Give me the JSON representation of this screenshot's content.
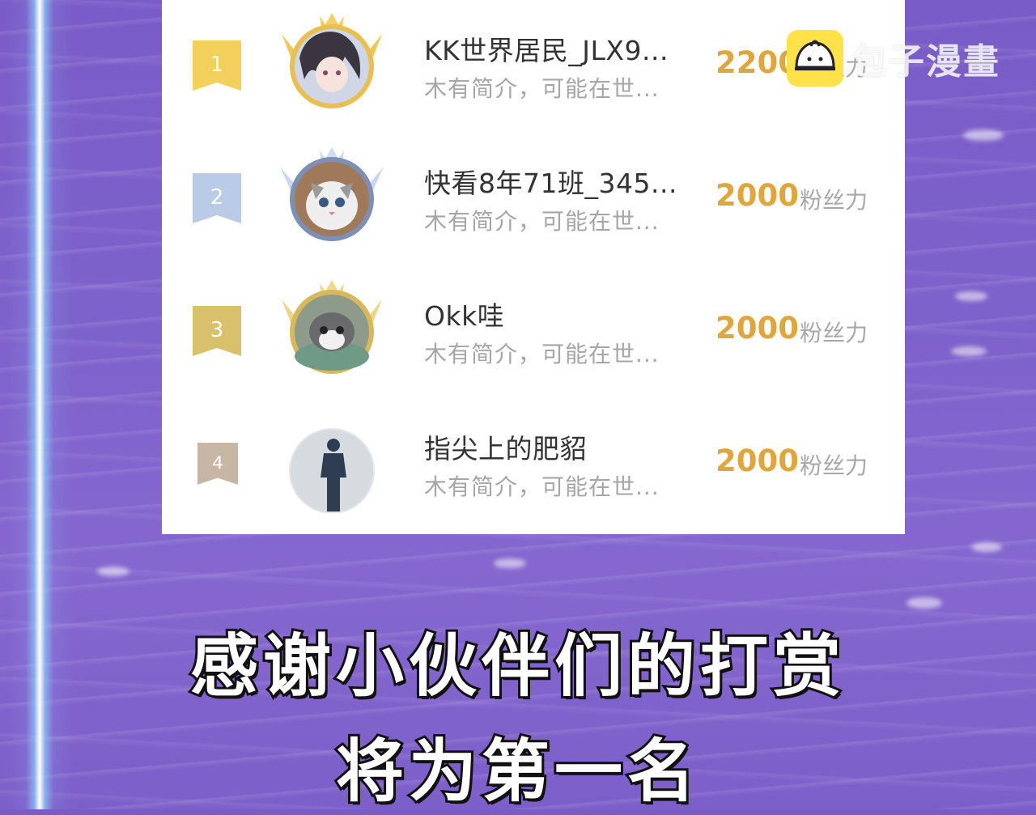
{
  "watermark": {
    "text": "包子漫畫",
    "icon": "bun-mascot-icon"
  },
  "ranking": [
    {
      "rank": "1",
      "name": "KK世界居民_JLX9...",
      "intro": "木有简介，可能在世...",
      "points": "2200",
      "unit": "粉丝力",
      "badge_color": "#f3cf5c",
      "frame": "gold"
    },
    {
      "rank": "2",
      "name": "快看8年71班_345...",
      "intro": "木有简介，可能在世...",
      "points": "2000",
      "unit": "粉丝力",
      "badge_color": "#b9cbe6",
      "frame": "silver"
    },
    {
      "rank": "3",
      "name": "Okk哇",
      "intro": "木有简介，可能在世...",
      "points": "2000",
      "unit": "粉丝力",
      "badge_color": "#d9c06d",
      "frame": "bronze-gold"
    },
    {
      "rank": "4",
      "name": "指尖上的肥貂",
      "intro": "木有简介，可能在世...",
      "points": "2000",
      "unit": "粉丝力",
      "badge_color": "#c8b6a4",
      "frame": "none"
    }
  ],
  "caption": {
    "line1": "感谢小伙伴们的打赏",
    "line2": "将为第一名"
  },
  "colors": {
    "points": "#e0a63e",
    "background": "#7e62cb"
  }
}
